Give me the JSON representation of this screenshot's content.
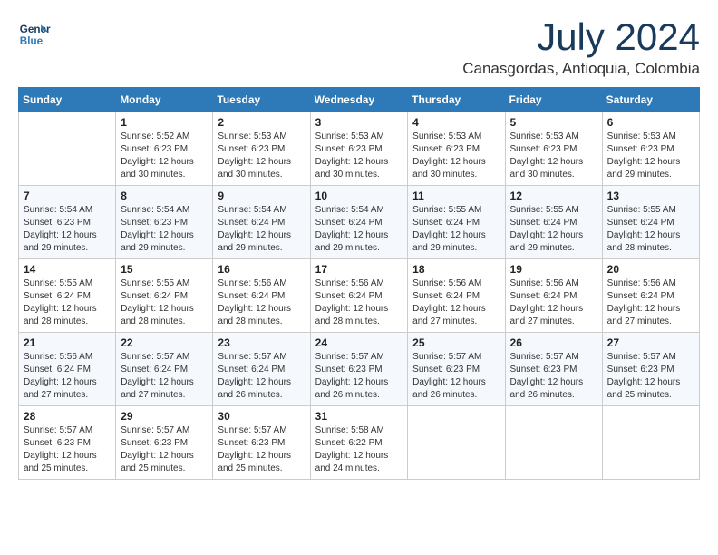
{
  "logo": {
    "line1": "General",
    "line2": "Blue"
  },
  "header": {
    "month_year": "July 2024",
    "location": "Canasgordas, Antioquia, Colombia"
  },
  "weekdays": [
    "Sunday",
    "Monday",
    "Tuesday",
    "Wednesday",
    "Thursday",
    "Friday",
    "Saturday"
  ],
  "weeks": [
    [
      {
        "day": "",
        "sunrise": "",
        "sunset": "",
        "daylight": ""
      },
      {
        "day": "1",
        "sunrise": "Sunrise: 5:52 AM",
        "sunset": "Sunset: 6:23 PM",
        "daylight": "Daylight: 12 hours and 30 minutes."
      },
      {
        "day": "2",
        "sunrise": "Sunrise: 5:53 AM",
        "sunset": "Sunset: 6:23 PM",
        "daylight": "Daylight: 12 hours and 30 minutes."
      },
      {
        "day": "3",
        "sunrise": "Sunrise: 5:53 AM",
        "sunset": "Sunset: 6:23 PM",
        "daylight": "Daylight: 12 hours and 30 minutes."
      },
      {
        "day": "4",
        "sunrise": "Sunrise: 5:53 AM",
        "sunset": "Sunset: 6:23 PM",
        "daylight": "Daylight: 12 hours and 30 minutes."
      },
      {
        "day": "5",
        "sunrise": "Sunrise: 5:53 AM",
        "sunset": "Sunset: 6:23 PM",
        "daylight": "Daylight: 12 hours and 30 minutes."
      },
      {
        "day": "6",
        "sunrise": "Sunrise: 5:53 AM",
        "sunset": "Sunset: 6:23 PM",
        "daylight": "Daylight: 12 hours and 29 minutes."
      }
    ],
    [
      {
        "day": "7",
        "sunrise": "Sunrise: 5:54 AM",
        "sunset": "Sunset: 6:23 PM",
        "daylight": "Daylight: 12 hours and 29 minutes."
      },
      {
        "day": "8",
        "sunrise": "Sunrise: 5:54 AM",
        "sunset": "Sunset: 6:23 PM",
        "daylight": "Daylight: 12 hours and 29 minutes."
      },
      {
        "day": "9",
        "sunrise": "Sunrise: 5:54 AM",
        "sunset": "Sunset: 6:24 PM",
        "daylight": "Daylight: 12 hours and 29 minutes."
      },
      {
        "day": "10",
        "sunrise": "Sunrise: 5:54 AM",
        "sunset": "Sunset: 6:24 PM",
        "daylight": "Daylight: 12 hours and 29 minutes."
      },
      {
        "day": "11",
        "sunrise": "Sunrise: 5:55 AM",
        "sunset": "Sunset: 6:24 PM",
        "daylight": "Daylight: 12 hours and 29 minutes."
      },
      {
        "day": "12",
        "sunrise": "Sunrise: 5:55 AM",
        "sunset": "Sunset: 6:24 PM",
        "daylight": "Daylight: 12 hours and 29 minutes."
      },
      {
        "day": "13",
        "sunrise": "Sunrise: 5:55 AM",
        "sunset": "Sunset: 6:24 PM",
        "daylight": "Daylight: 12 hours and 28 minutes."
      }
    ],
    [
      {
        "day": "14",
        "sunrise": "Sunrise: 5:55 AM",
        "sunset": "Sunset: 6:24 PM",
        "daylight": "Daylight: 12 hours and 28 minutes."
      },
      {
        "day": "15",
        "sunrise": "Sunrise: 5:55 AM",
        "sunset": "Sunset: 6:24 PM",
        "daylight": "Daylight: 12 hours and 28 minutes."
      },
      {
        "day": "16",
        "sunrise": "Sunrise: 5:56 AM",
        "sunset": "Sunset: 6:24 PM",
        "daylight": "Daylight: 12 hours and 28 minutes."
      },
      {
        "day": "17",
        "sunrise": "Sunrise: 5:56 AM",
        "sunset": "Sunset: 6:24 PM",
        "daylight": "Daylight: 12 hours and 28 minutes."
      },
      {
        "day": "18",
        "sunrise": "Sunrise: 5:56 AM",
        "sunset": "Sunset: 6:24 PM",
        "daylight": "Daylight: 12 hours and 27 minutes."
      },
      {
        "day": "19",
        "sunrise": "Sunrise: 5:56 AM",
        "sunset": "Sunset: 6:24 PM",
        "daylight": "Daylight: 12 hours and 27 minutes."
      },
      {
        "day": "20",
        "sunrise": "Sunrise: 5:56 AM",
        "sunset": "Sunset: 6:24 PM",
        "daylight": "Daylight: 12 hours and 27 minutes."
      }
    ],
    [
      {
        "day": "21",
        "sunrise": "Sunrise: 5:56 AM",
        "sunset": "Sunset: 6:24 PM",
        "daylight": "Daylight: 12 hours and 27 minutes."
      },
      {
        "day": "22",
        "sunrise": "Sunrise: 5:57 AM",
        "sunset": "Sunset: 6:24 PM",
        "daylight": "Daylight: 12 hours and 27 minutes."
      },
      {
        "day": "23",
        "sunrise": "Sunrise: 5:57 AM",
        "sunset": "Sunset: 6:24 PM",
        "daylight": "Daylight: 12 hours and 26 minutes."
      },
      {
        "day": "24",
        "sunrise": "Sunrise: 5:57 AM",
        "sunset": "Sunset: 6:23 PM",
        "daylight": "Daylight: 12 hours and 26 minutes."
      },
      {
        "day": "25",
        "sunrise": "Sunrise: 5:57 AM",
        "sunset": "Sunset: 6:23 PM",
        "daylight": "Daylight: 12 hours and 26 minutes."
      },
      {
        "day": "26",
        "sunrise": "Sunrise: 5:57 AM",
        "sunset": "Sunset: 6:23 PM",
        "daylight": "Daylight: 12 hours and 26 minutes."
      },
      {
        "day": "27",
        "sunrise": "Sunrise: 5:57 AM",
        "sunset": "Sunset: 6:23 PM",
        "daylight": "Daylight: 12 hours and 25 minutes."
      }
    ],
    [
      {
        "day": "28",
        "sunrise": "Sunrise: 5:57 AM",
        "sunset": "Sunset: 6:23 PM",
        "daylight": "Daylight: 12 hours and 25 minutes."
      },
      {
        "day": "29",
        "sunrise": "Sunrise: 5:57 AM",
        "sunset": "Sunset: 6:23 PM",
        "daylight": "Daylight: 12 hours and 25 minutes."
      },
      {
        "day": "30",
        "sunrise": "Sunrise: 5:57 AM",
        "sunset": "Sunset: 6:23 PM",
        "daylight": "Daylight: 12 hours and 25 minutes."
      },
      {
        "day": "31",
        "sunrise": "Sunrise: 5:58 AM",
        "sunset": "Sunset: 6:22 PM",
        "daylight": "Daylight: 12 hours and 24 minutes."
      },
      {
        "day": "",
        "sunrise": "",
        "sunset": "",
        "daylight": ""
      },
      {
        "day": "",
        "sunrise": "",
        "sunset": "",
        "daylight": ""
      },
      {
        "day": "",
        "sunrise": "",
        "sunset": "",
        "daylight": ""
      }
    ]
  ]
}
